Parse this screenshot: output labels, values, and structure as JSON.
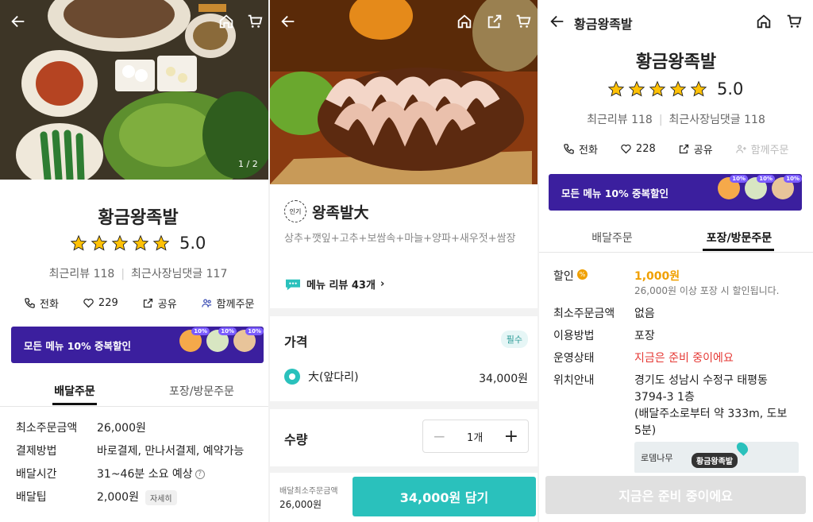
{
  "colors": {
    "accent": "#2ac1bc",
    "banner": "#3b1f9e",
    "star": "#ffc107",
    "alert": "#e53935",
    "discount": "#f0a000"
  },
  "screen1": {
    "image_counter": "1 / 2",
    "store_name": "황금왕족발",
    "rating": "5.0",
    "recent_reviews": "최근리뷰 118",
    "owner_replies": "최근사장님댓글 117",
    "actions": {
      "call": "전화",
      "likes": "229",
      "share": "공유",
      "group_order": "함께주문"
    },
    "banner_text": "모든 메뉴 10% 중복할인",
    "banner_tag": "10%",
    "tabs": {
      "delivery": "배달주문",
      "pickup": "포장/방문주문"
    },
    "info": {
      "min_order_label": "최소주문금액",
      "min_order_value": "26,000원",
      "payment_label": "결제방법",
      "payment_value": "바로결제, 만나서결제, 예약가능",
      "delivery_time_label": "배달시간",
      "delivery_time_value": "31~46분 소요 예상",
      "delivery_tip_label": "배달팁",
      "delivery_tip_value": "2,000원",
      "detail_chip": "자세히"
    }
  },
  "screen2": {
    "popular_badge": "인기",
    "menu_name": "왕족발大",
    "menu_desc": "상추+깻잎+고추+보쌈속+마늘+양파+새우젓+쌈장",
    "menu_review": "메뉴 리뷰 43개",
    "price_title": "가격",
    "required_badge": "필수",
    "option_label": "大(앞다리)",
    "option_price": "34,000원",
    "qty_title": "수량",
    "qty_value": "1개",
    "min_order_caption": "배달최소주문금액",
    "min_order_value": "26,000원",
    "add_to_cart": "34,000원 담기"
  },
  "screen3": {
    "header_title": "황금왕족발",
    "store_name": "황금왕족발",
    "rating": "5.0",
    "recent_reviews": "최근리뷰 118",
    "owner_replies": "최근사장님댓글 118",
    "actions": {
      "call": "전화",
      "likes": "228",
      "share": "공유",
      "group_order": "함께주문"
    },
    "banner_text": "모든 메뉴 10% 중복할인",
    "banner_tag": "10%",
    "tabs": {
      "delivery": "배달주문",
      "pickup": "포장/방문주문"
    },
    "info": {
      "discount_label": "할인",
      "discount_value": "1,000원",
      "discount_note": "26,000원 이상 포장 시 할인됩니다.",
      "min_order_label": "최소주문금액",
      "min_order_value": "없음",
      "usage_label": "이용방법",
      "usage_value": "포장",
      "status_label": "운영상태",
      "status_value": "지금은 준비 중이에요",
      "location_label": "위치안내",
      "location_line1": "경기도 성남시 수정구 태평동",
      "location_line2": "3794-3 1층",
      "location_line3": "(배달주소로부터 약 333m, 도보",
      "location_line4": "5분)"
    },
    "map_pin_label": "황금왕족발",
    "map_place_label": "로뎀나무",
    "bottom_button": "지금은 준비 중이에요"
  }
}
